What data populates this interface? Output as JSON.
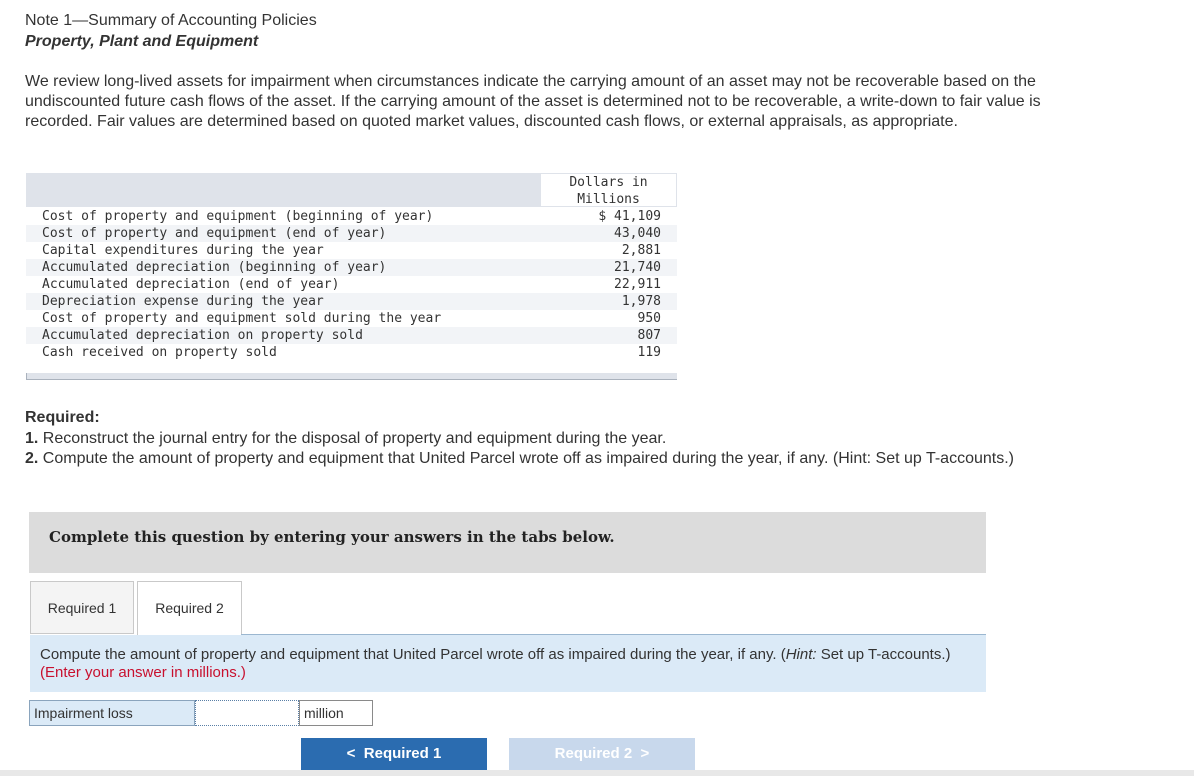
{
  "note": {
    "title": "Note 1—Summary of Accounting Policies",
    "subtitle": "Property, Plant and Equipment"
  },
  "intro": "We review long-lived assets for impairment when circumstances indicate the carrying amount of an asset may not be recoverable based on the undiscounted future cash flows of the asset. If the carrying amount of the asset is determined not to be recoverable, a write-down to fair value is recorded. Fair values are determined based on quoted market values, discounted cash flows, or external appraisals, as appropriate.",
  "table": {
    "column_header": "Dollars in\nMillions",
    "rows": [
      {
        "label": "Cost of property and equipment (beginning of year)",
        "value": "$ 41,109"
      },
      {
        "label": "Cost of property and equipment (end of year)",
        "value": "43,040"
      },
      {
        "label": "Capital expenditures during the year",
        "value": "2,881"
      },
      {
        "label": "Accumulated depreciation (beginning of year)",
        "value": "21,740"
      },
      {
        "label": "Accumulated depreciation (end of year)",
        "value": "22,911"
      },
      {
        "label": "Depreciation expense during the year",
        "value": "1,978"
      },
      {
        "label": "Cost of property and equipment sold during the year",
        "value": "950"
      },
      {
        "label": "Accumulated depreciation on property sold",
        "value": "807"
      },
      {
        "label": "Cash received on property sold",
        "value": "119"
      }
    ]
  },
  "required": {
    "heading": "Required:",
    "items": [
      {
        "num": "1.",
        "text": "Reconstruct the journal entry for the disposal of property and equipment during the year."
      },
      {
        "num": "2.",
        "text": "Compute the amount of property and equipment that United Parcel wrote off as impaired during the year, if any. (Hint: Set up T-accounts.)"
      }
    ]
  },
  "banner": "Complete this question by entering your answers in the tabs below.",
  "tabs": [
    {
      "label": "Required 1",
      "active": false
    },
    {
      "label": "Required 2",
      "active": true
    }
  ],
  "panel": {
    "text_a": "Compute the amount of property and equipment that United Parcel wrote off as impaired during the year, if any. (",
    "hint": "Hint:",
    "text_b": " Set up T-accounts.) ",
    "red": "(Enter your answer in millions.)"
  },
  "answer": {
    "label": "Impairment loss",
    "value": "",
    "unit": "million"
  },
  "nav": {
    "prev_label": "Required 1",
    "next_label": "Required 2",
    "prev_icon": "chevron-left-icon",
    "next_icon": "chevron-right-icon"
  },
  "colors": {
    "accent": "#2b6cb0",
    "panel_bg": "#dbeaf7",
    "hint_red": "#c8102e",
    "disabled_btn": "#c8d8ec"
  }
}
